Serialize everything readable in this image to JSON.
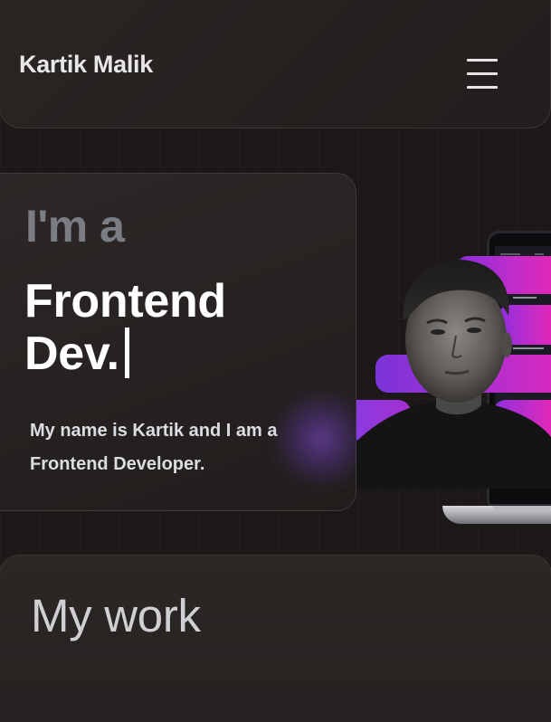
{
  "header": {
    "brand": "Kartik Malik",
    "menu_icon": "hamburger-menu-icon"
  },
  "hero": {
    "intro": "I'm a",
    "role_line1": "Frontend",
    "role_line2": "Dev.",
    "description": "My name is Kartik and I am a Frontend Developer."
  },
  "work": {
    "title": "My work"
  },
  "colors": {
    "background": "#1c1817",
    "card": "#2a2523",
    "accent_purple": "#8b2ee0",
    "accent_pink": "#e028b8",
    "muted_text": "#7b7d85"
  }
}
